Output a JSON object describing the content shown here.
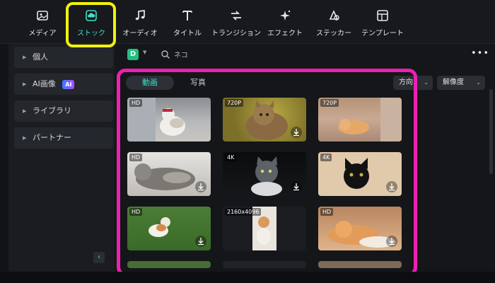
{
  "toolbar": {
    "items": [
      {
        "label": "メディア",
        "icon": "media-icon"
      },
      {
        "label": "ストック",
        "icon": "stock-cloud-icon",
        "active": true
      },
      {
        "label": "オーディオ",
        "icon": "music-note-icon"
      },
      {
        "label": "タイトル",
        "icon": "title-t-icon"
      },
      {
        "label": "トランジション",
        "icon": "transition-icon"
      },
      {
        "label": "エフェクト",
        "icon": "effect-sparkle-icon"
      },
      {
        "label": "ステッカー",
        "icon": "sticker-icon"
      },
      {
        "label": "テンプレート",
        "icon": "template-icon"
      }
    ]
  },
  "sidebar": {
    "items": [
      {
        "label": "個人"
      },
      {
        "label": "AI画像",
        "badge": "AI"
      },
      {
        "label": "ライブラリ"
      },
      {
        "label": "パートナー"
      }
    ]
  },
  "search": {
    "value": "ネコ",
    "library_letter": "D"
  },
  "tabs": [
    {
      "label": "動画",
      "active": true
    },
    {
      "label": "写真",
      "active": false
    }
  ],
  "filters": {
    "direction": "方向",
    "resolution": "解像度"
  },
  "thumbnails": [
    {
      "badge": "HD",
      "download": false
    },
    {
      "badge": "720P",
      "download": true
    },
    {
      "badge": "720P",
      "download": false
    },
    {
      "badge": "HD",
      "download": true
    },
    {
      "badge": "4K",
      "download": true
    },
    {
      "badge": "4K",
      "download": true
    },
    {
      "badge": "HD",
      "download": true
    },
    {
      "badge": "2160x4096",
      "download": false
    },
    {
      "badge": "HD",
      "download": true
    }
  ],
  "colors": {
    "accent": "#3fe0c5",
    "highlight_yellow": "#f2f20d",
    "highlight_pink": "#ef1fb2"
  }
}
